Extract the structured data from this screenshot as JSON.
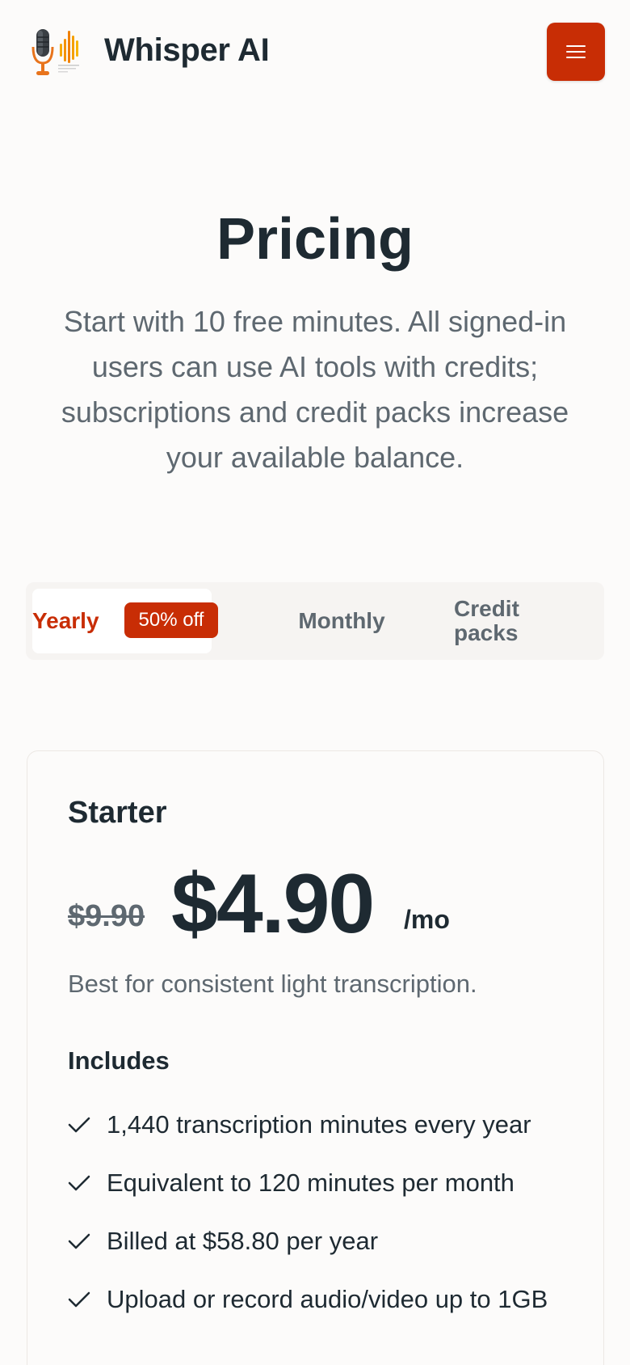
{
  "header": {
    "brand": "Whisper AI",
    "logo_icon": "microphone-soundwave-icon",
    "menu_icon": "hamburger-menu-icon"
  },
  "hero": {
    "title": "Pricing",
    "subtitle": "Start with 10 free minutes. All signed-in users can use AI tools with credits; subscriptions and credit packs increase your available balance."
  },
  "tabs": {
    "yearly": "Yearly",
    "yearly_badge": "50% off",
    "monthly": "Monthly",
    "credits_line1": "Credit",
    "credits_line2": "packs",
    "selected": "Yearly"
  },
  "plan": {
    "name": "Starter",
    "old_price": "$9.90",
    "price": "$4.90",
    "period": "/mo",
    "description": "Best for consistent light transcription.",
    "includes_label": "Includes",
    "features": [
      "1,440 transcription minutes every year",
      "Equivalent to 120 minutes per month",
      "Billed at $58.80 per year",
      "Upload or record audio/video up to 1GB"
    ]
  },
  "colors": {
    "accent": "#c82d05",
    "text": "#1e2a32",
    "muted": "#5e6870",
    "background": "#fcfbfa"
  }
}
